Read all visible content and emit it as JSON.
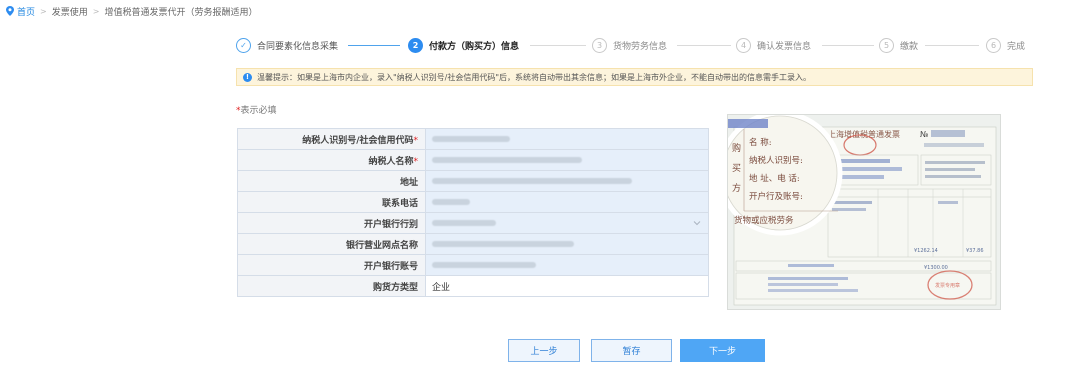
{
  "breadcrumb": {
    "home": "首页",
    "level2": "发票使用",
    "level3": "增值税普通发票代开（劳务报酬适用）"
  },
  "steps": [
    {
      "num": "✓",
      "label": "合同要素化信息采集",
      "state": "done"
    },
    {
      "num": "2",
      "label": "付款方（购买方）信息",
      "state": "active"
    },
    {
      "num": "3",
      "label": "货物劳务信息",
      "state": "pending"
    },
    {
      "num": "4",
      "label": "确认发票信息",
      "state": "pending"
    },
    {
      "num": "5",
      "label": "缴款",
      "state": "pending"
    },
    {
      "num": "6",
      "label": "完成",
      "state": "pending"
    }
  ],
  "notice": {
    "icon": "!",
    "text": "温馨提示：如果是上海市内企业，录入\"纳税人识别号/社会信用代码\"后，系统将自动带出其余信息；如果是上海市外企业，不能自动带出的信息需手工录入。"
  },
  "required_note": "表示必填",
  "form": {
    "rows": [
      {
        "label": "纳税人识别号/社会信用代码",
        "required": true
      },
      {
        "label": "纳税人名称",
        "required": true
      },
      {
        "label": "地址",
        "required": false
      },
      {
        "label": "联系电话",
        "required": false
      },
      {
        "label": "开户银行行别",
        "required": false
      },
      {
        "label": "银行营业网点名称",
        "required": false
      },
      {
        "label": "开户银行账号",
        "required": false
      },
      {
        "label": "购货方类型",
        "required": false
      }
    ],
    "buyer_type_value": "企业"
  },
  "invoice_sample": {
    "title": "上海增值税普通发票",
    "no_label": "№",
    "zoom_side": "购买方",
    "zoom_lines": [
      "名        称:",
      "纳税人识别号:",
      "地  址、电  话:",
      "开户行及账号:"
    ],
    "zoom_footer": "货物或应税劳务",
    "amount1": "¥1262.14",
    "amount2": "¥37.86",
    "amount3": "¥1300.00",
    "seal_text": "发票专用章"
  },
  "buttons": {
    "prev": "上一步",
    "save": "暂存",
    "next": "下一步"
  },
  "colors": {
    "accent": "#2d8cf0",
    "notice_bg": "#fdf4dc",
    "required": "#e02020",
    "primary_button": "#4fa6f5"
  }
}
